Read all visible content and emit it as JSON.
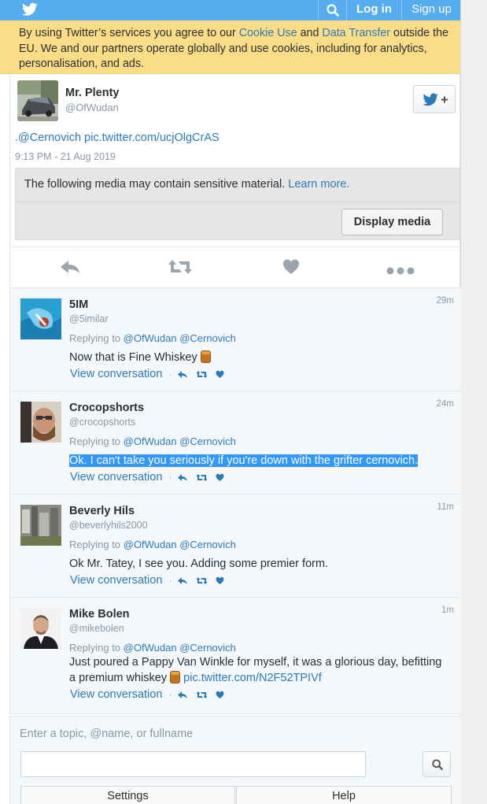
{
  "topbar": {
    "search_icon": "search-icon",
    "login": "Log in",
    "signup": "Sign up",
    "brand_color": "#55acee"
  },
  "cookie_banner": {
    "prefix": "By using Twitter’s services you agree to our ",
    "cookie_link": "Cookie Use",
    "and": " and ",
    "transfer_link": "Data Transfer",
    "suffix": " outside the EU. We and our partners operate globally and use cookies, including for analytics, personalisation, and ads."
  },
  "tweet": {
    "name": "Mr. Plenty",
    "handle": "@OfWudan",
    "text": ".@Cernovich pic.twitter.com/ucjOlgCrAS",
    "time": "9:13 PM - 21 Aug 2019",
    "sensitive_msg": "The following media may contain sensitive material.",
    "learn_more": "Learn more.",
    "display_media": "Display media"
  },
  "replies": [
    {
      "name": "5IM",
      "handle": "@5imilar",
      "time": "29m",
      "replying_label": "Replying to",
      "to1": "@OfWudan",
      "to2": "@Cernovich",
      "text": "Now that is Fine Whiskey",
      "view": "View conversation"
    },
    {
      "name": "Crocopshorts",
      "handle": "@crocopshorts",
      "time": "24m",
      "replying_label": "Replying to",
      "to1": "@OfWudan",
      "to2": "@Cernovich",
      "text": "Ok. I can't take you seriously if you're down with the grifter cernovich.",
      "view": "View conversation"
    },
    {
      "name": "Beverly Hils",
      "handle": "@beverlyhils2000",
      "time": "11m",
      "replying_label": "Replying to",
      "to1": "@OfWudan",
      "to2": "@Cernovich",
      "text": "Ok Mr. Tatey, I see you. Adding some premier form.",
      "view": "View conversation"
    },
    {
      "name": "Mike Bolen",
      "handle": "@mikebolen",
      "time": "1m",
      "replying_label": "Replying to",
      "to1": "@OfWudan",
      "to2": "@Cernovich",
      "text": "Just poured a Pappy Van Winkle for myself, it was a glorious day, befitting a premium whiskey",
      "link": "pic.twitter.com/N2F52TPIVf",
      "view": "View conversation"
    }
  ],
  "search": {
    "label": "Enter a topic, @name, or fullname",
    "value": "",
    "settings": "Settings",
    "help": "Help"
  }
}
